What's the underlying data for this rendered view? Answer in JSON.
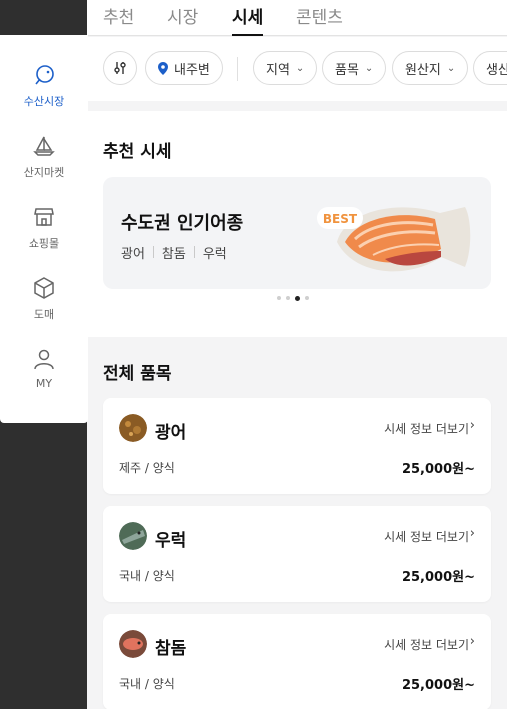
{
  "top_tabs": [
    "추천",
    "시장",
    "시세",
    "콘텐츠"
  ],
  "active_tab": "시세",
  "filters": {
    "location": "내주변",
    "chips": [
      "지역",
      "품목",
      "원산지",
      "생산"
    ]
  },
  "sidebar": {
    "items": [
      {
        "label": "수산시장",
        "icon": "fish-icon",
        "active": true
      },
      {
        "label": "산지마켓",
        "icon": "sailboat-icon",
        "active": false
      },
      {
        "label": "쇼핑몰",
        "icon": "store-icon",
        "active": false
      },
      {
        "label": "도매",
        "icon": "box-icon",
        "active": false
      },
      {
        "label": "MY",
        "icon": "user-icon",
        "active": false
      }
    ]
  },
  "recommend": {
    "title": "추천 시세",
    "banner_title": "수도권 인기어종",
    "banner_tags": [
      "광어",
      "참돔",
      "우럭"
    ],
    "badge": "BEST",
    "slide_count": 4,
    "active_slide": 3
  },
  "all_items": {
    "title": "전체 품목",
    "more_label": "시세 정보 더보기",
    "items": [
      {
        "name": "광어",
        "origin": "제주 / 양식",
        "price": "25,000원~"
      },
      {
        "name": "우럭",
        "origin": "국내 / 양식",
        "price": "25,000원~"
      },
      {
        "name": "참돔",
        "origin": "국내 / 양식",
        "price": "25,000원~"
      }
    ]
  },
  "colors": {
    "accent": "#1c5fc9",
    "background": "#f4f4f5"
  }
}
